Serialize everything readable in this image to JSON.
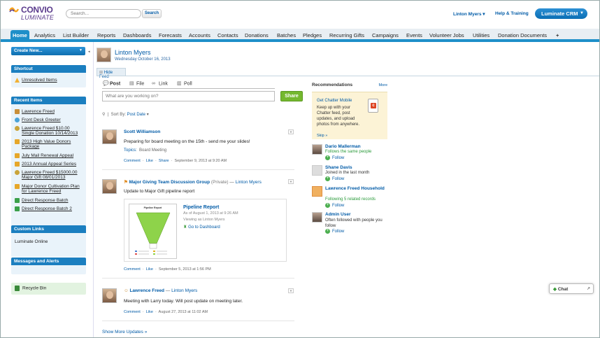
{
  "header": {
    "logo_top": "CONVIO",
    "logo_bottom": "LUMINATE",
    "search_placeholder": "Search...",
    "search_button": "Search",
    "user_menu": "Linton Myers",
    "help": "Help & Training",
    "app_switcher": "Luminate CRM"
  },
  "tabs": [
    "Home",
    "Analytics",
    "List Builder",
    "Reports",
    "Dashboards",
    "Forecasts",
    "Accounts",
    "Contacts",
    "Donations",
    "Batches",
    "Pledges",
    "Recurring Gifts",
    "Campaigns",
    "Events",
    "Volunteer Jobs",
    "Utilities",
    "Donation Documents",
    "+"
  ],
  "sidebar": {
    "create_new": "Create New...",
    "shortcut_title": "Shortcut",
    "shortcut_item": "Unresolved Items",
    "recent_title": "Recent Items",
    "recent_items": [
      "Lawrence Freed",
      "Front Desk Greeter",
      "Lawrence Freed $10.00 Single Donation 10/14/2013",
      "2013 High Value Donors Package",
      "July Mail Renewal Appeal",
      "2013 Annual Appeal Series",
      "Lawrence Freed $15000.00 Major Gift 08/01/2013",
      "Major Donor Cultivation Plan for Lawrence Freed",
      "Direct Response Batch",
      "Direct Response Batch 2"
    ],
    "custom_links_title": "Custom Links",
    "custom_link": "Luminate Online",
    "messages_title": "Messages and Alerts",
    "recycle_bin": "Recycle Bin"
  },
  "profile": {
    "name": "Linton Myers",
    "date": "Wednesday October 16, 2013",
    "hide_feed": "Hide Feed"
  },
  "publisher": {
    "options": [
      "Post",
      "File",
      "Link",
      "Poll"
    ],
    "placeholder": "What are you working on?",
    "share": "Share",
    "sort_by_label": "Sort By:",
    "sort_by_value": "Post Date"
  },
  "feed": [
    {
      "author": "Scott Williamson",
      "text": "Preparing for board meeting on the 15th - send me your slides!",
      "topics_label": "Topics:",
      "topic": "Board Meeting",
      "actions": [
        "Comment",
        "Like",
        "Share"
      ],
      "time": "September 9, 2013 at 9:20 AM"
    },
    {
      "group": "Major Giving Team Discussion Group",
      "private": "(Private)",
      "arrow": "—",
      "target": "Linton Myers",
      "text": "Update to Major Gift pipeline report",
      "attachment_title": "Pipeline Report",
      "attachment_asof": "As of August 1, 2013 at 9:26 AM",
      "attachment_via": "Viewing as Linton Myers",
      "attachment_link": "Go to Dashboard",
      "thumb_title": "Pipeline Report",
      "actions": [
        "Comment",
        "Like"
      ],
      "time": "September 5, 2013 at 1:56 PM"
    },
    {
      "author": "Lawrence Freed",
      "arrow": "—",
      "target": "Linton Myers",
      "text": "Meeting with Larry today. Will post update on meeting later.",
      "actions": [
        "Comment",
        "Like"
      ],
      "time": "August 27, 2013 at 11:02 AM"
    }
  ],
  "show_more": "Show More Updates »",
  "recommendations": {
    "title": "Recommendations",
    "more": "More",
    "mobile_title": "Get Chatter Mobile",
    "mobile_desc": "Keep up with your Chatter feed, post updates, and upload photos from anywhere.",
    "mobile_skip": "Skip »",
    "people": [
      {
        "name": "Dario Mallerman",
        "desc": "Follows the same people",
        "follow": "Follow"
      },
      {
        "name": "Shane Davis",
        "desc": "Joined in the last month",
        "follow": "Follow"
      },
      {
        "name": "Lawrence Freed Household",
        "desc": "Following 5 related records",
        "follow": "Follow"
      },
      {
        "name": "Admin User",
        "desc": "Often followed with people you follow",
        "follow": "Follow"
      }
    ]
  },
  "chat": "Chat",
  "colors": {
    "accent": "#1e8fc9",
    "share": "#74b82e",
    "link": "#015ba7"
  }
}
